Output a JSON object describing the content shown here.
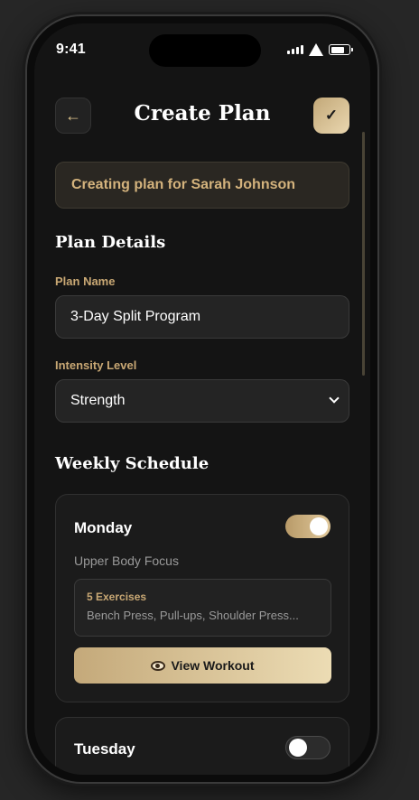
{
  "status_bar": {
    "time": "9:41"
  },
  "header": {
    "title": "Create Plan",
    "back_icon": "←",
    "save_icon": "✓"
  },
  "client_banner": "Creating plan for Sarah Johnson",
  "plan_details": {
    "heading": "Plan Details",
    "name_label": "Plan Name",
    "name_value": "3-Day Split Program",
    "intensity_label": "Intensity Level",
    "intensity_value": "Strength"
  },
  "weekly_schedule": {
    "heading": "Weekly Schedule",
    "days": [
      {
        "name": "Monday",
        "enabled": true,
        "focus": "Upper Body Focus",
        "exercise_count": "5 Exercises",
        "exercise_list": "Bench Press, Pull-ups, Shoulder Press...",
        "view_label": "View Workout"
      },
      {
        "name": "Tuesday",
        "enabled": false
      }
    ]
  },
  "colors": {
    "accent": "#c9a874",
    "background": "#141414",
    "card": "#1b1b1b"
  }
}
